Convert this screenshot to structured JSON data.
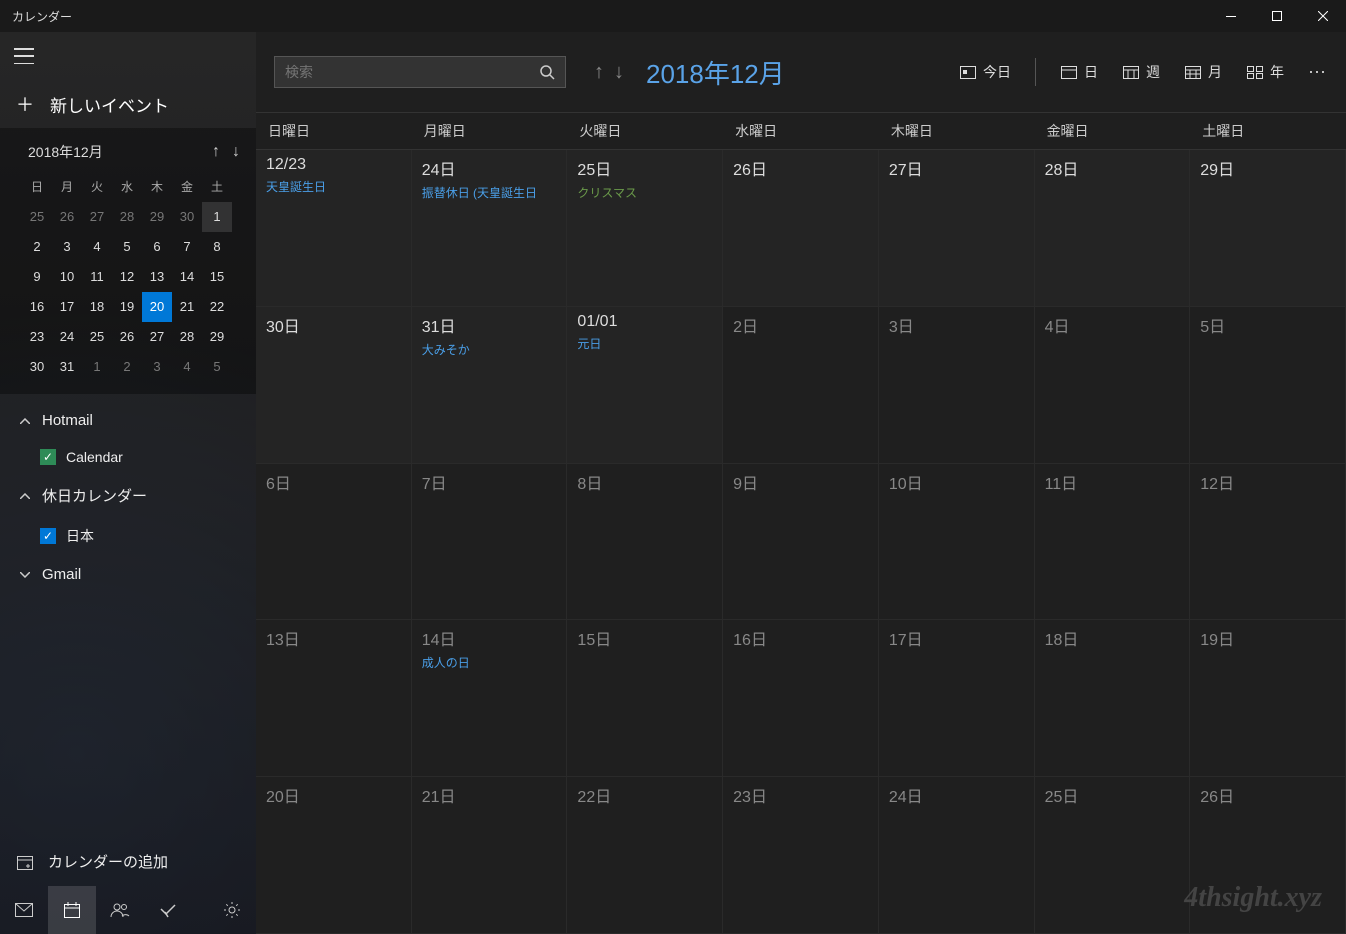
{
  "window": {
    "title": "カレンダー"
  },
  "sidebar": {
    "new_event": "新しいイベント",
    "mini_cal": {
      "title": "2018年12月",
      "day_headers": [
        "日",
        "月",
        "火",
        "水",
        "木",
        "金",
        "土"
      ],
      "weeks": [
        [
          {
            "n": "25",
            "o": true
          },
          {
            "n": "26",
            "o": true
          },
          {
            "n": "27",
            "o": true
          },
          {
            "n": "28",
            "o": true
          },
          {
            "n": "29",
            "o": true
          },
          {
            "n": "30",
            "o": true
          },
          {
            "n": "1",
            "box": true
          }
        ],
        [
          {
            "n": "2"
          },
          {
            "n": "3"
          },
          {
            "n": "4"
          },
          {
            "n": "5"
          },
          {
            "n": "6"
          },
          {
            "n": "7"
          },
          {
            "n": "8"
          }
        ],
        [
          {
            "n": "9"
          },
          {
            "n": "10"
          },
          {
            "n": "11"
          },
          {
            "n": "12"
          },
          {
            "n": "13"
          },
          {
            "n": "14"
          },
          {
            "n": "15"
          }
        ],
        [
          {
            "n": "16"
          },
          {
            "n": "17"
          },
          {
            "n": "18"
          },
          {
            "n": "19"
          },
          {
            "n": "20",
            "today": true
          },
          {
            "n": "21"
          },
          {
            "n": "22"
          }
        ],
        [
          {
            "n": "23"
          },
          {
            "n": "24"
          },
          {
            "n": "25"
          },
          {
            "n": "26"
          },
          {
            "n": "27"
          },
          {
            "n": "28"
          },
          {
            "n": "29"
          }
        ],
        [
          {
            "n": "30"
          },
          {
            "n": "31"
          },
          {
            "n": "1",
            "o": true
          },
          {
            "n": "2",
            "o": true
          },
          {
            "n": "3",
            "o": true
          },
          {
            "n": "4",
            "o": true
          },
          {
            "n": "5",
            "o": true
          }
        ]
      ]
    },
    "groups": [
      {
        "name": "Hotmail",
        "expanded": true,
        "items": [
          {
            "label": "Calendar",
            "checked": true,
            "color": "green"
          }
        ]
      },
      {
        "name": "休日カレンダー",
        "expanded": true,
        "items": [
          {
            "label": "日本",
            "checked": true,
            "color": "blue"
          }
        ]
      },
      {
        "name": "Gmail",
        "expanded": false,
        "items": []
      }
    ],
    "add_cals": "カレンダーの追加"
  },
  "toolbar": {
    "search_placeholder": "検索",
    "period": "2018年12月",
    "today": "今日",
    "views": {
      "day": "日",
      "week": "週",
      "month": "月",
      "year": "年"
    }
  },
  "weekday_headers": [
    "日曜日",
    "月曜日",
    "火曜日",
    "水曜日",
    "木曜日",
    "金曜日",
    "土曜日"
  ],
  "weeks": [
    [
      {
        "label": "12/23",
        "current": true,
        "events": [
          {
            "text": "天皇誕生日",
            "c": "blue"
          }
        ]
      },
      {
        "label": "24日",
        "current": true,
        "events": [
          {
            "text": "振替休日 (天皇誕生日",
            "c": "blue"
          }
        ]
      },
      {
        "label": "25日",
        "current": true,
        "events": [
          {
            "text": "クリスマス",
            "c": "green"
          }
        ]
      },
      {
        "label": "26日",
        "current": true,
        "events": []
      },
      {
        "label": "27日",
        "current": true,
        "events": []
      },
      {
        "label": "28日",
        "current": true,
        "events": []
      },
      {
        "label": "29日",
        "current": true,
        "events": []
      }
    ],
    [
      {
        "label": "30日",
        "current": true,
        "events": []
      },
      {
        "label": "31日",
        "current": true,
        "events": [
          {
            "text": "大みそか",
            "c": "blue"
          }
        ]
      },
      {
        "label": "01/01",
        "current": true,
        "events": [
          {
            "text": "元日",
            "c": "blue"
          }
        ]
      },
      {
        "label": "2日",
        "current": false,
        "events": []
      },
      {
        "label": "3日",
        "current": false,
        "events": []
      },
      {
        "label": "4日",
        "current": false,
        "events": []
      },
      {
        "label": "5日",
        "current": false,
        "events": []
      }
    ],
    [
      {
        "label": "6日",
        "current": false,
        "events": []
      },
      {
        "label": "7日",
        "current": false,
        "events": []
      },
      {
        "label": "8日",
        "current": false,
        "events": []
      },
      {
        "label": "9日",
        "current": false,
        "events": []
      },
      {
        "label": "10日",
        "current": false,
        "events": []
      },
      {
        "label": "11日",
        "current": false,
        "events": []
      },
      {
        "label": "12日",
        "current": false,
        "events": []
      }
    ],
    [
      {
        "label": "13日",
        "current": false,
        "events": []
      },
      {
        "label": "14日",
        "current": false,
        "events": [
          {
            "text": "成人の日",
            "c": "blue"
          }
        ]
      },
      {
        "label": "15日",
        "current": false,
        "events": []
      },
      {
        "label": "16日",
        "current": false,
        "events": []
      },
      {
        "label": "17日",
        "current": false,
        "events": []
      },
      {
        "label": "18日",
        "current": false,
        "events": []
      },
      {
        "label": "19日",
        "current": false,
        "events": []
      }
    ],
    [
      {
        "label": "20日",
        "current": false,
        "events": []
      },
      {
        "label": "21日",
        "current": false,
        "events": []
      },
      {
        "label": "22日",
        "current": false,
        "events": []
      },
      {
        "label": "23日",
        "current": false,
        "events": []
      },
      {
        "label": "24日",
        "current": false,
        "events": []
      },
      {
        "label": "25日",
        "current": false,
        "events": []
      },
      {
        "label": "26日",
        "current": false,
        "events": []
      }
    ]
  ],
  "watermark": "4thsight.xyz"
}
